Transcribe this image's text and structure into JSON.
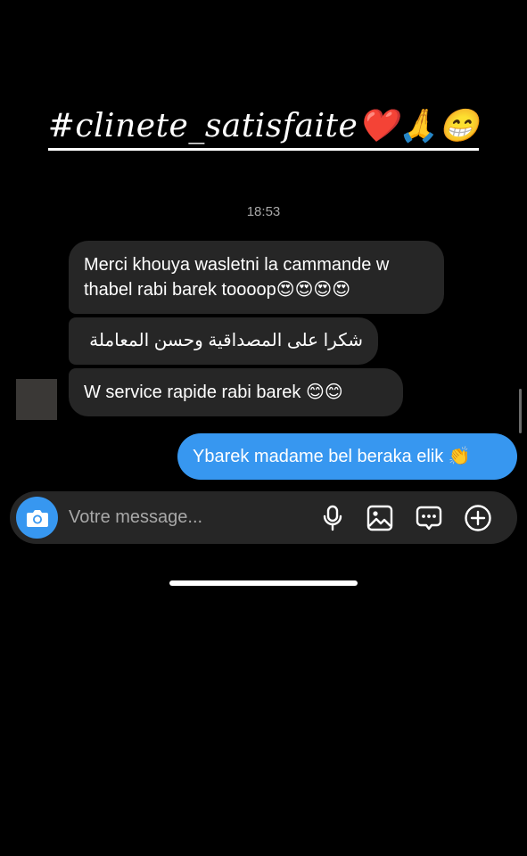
{
  "story": {
    "caption": "#clinete_satisfaite❤️🙏😁"
  },
  "thread": {
    "timestamp": "18:53",
    "messages": [
      {
        "direction": "incoming",
        "text": "Merci khouya wasletni la cammande w thabel rabi barek toooop😍😍😍😍"
      },
      {
        "direction": "incoming",
        "text": "شكرا على المصداقية وحسن المعاملة"
      },
      {
        "direction": "incoming",
        "text": "W service rapide rabi barek 😊😊"
      },
      {
        "direction": "outgoing",
        "text": "Ybarek madame bel beraka elik 👏"
      }
    ]
  },
  "composer": {
    "placeholder": "Votre message...",
    "value": "",
    "icons": [
      "camera-icon",
      "microphone-icon",
      "gallery-icon",
      "sticker-icon",
      "plus-icon"
    ]
  },
  "colors": {
    "background": "#000000",
    "incoming_bubble": "#262626",
    "outgoing_bubble": "#3797f0",
    "timestamp": "#a8a8a8"
  }
}
